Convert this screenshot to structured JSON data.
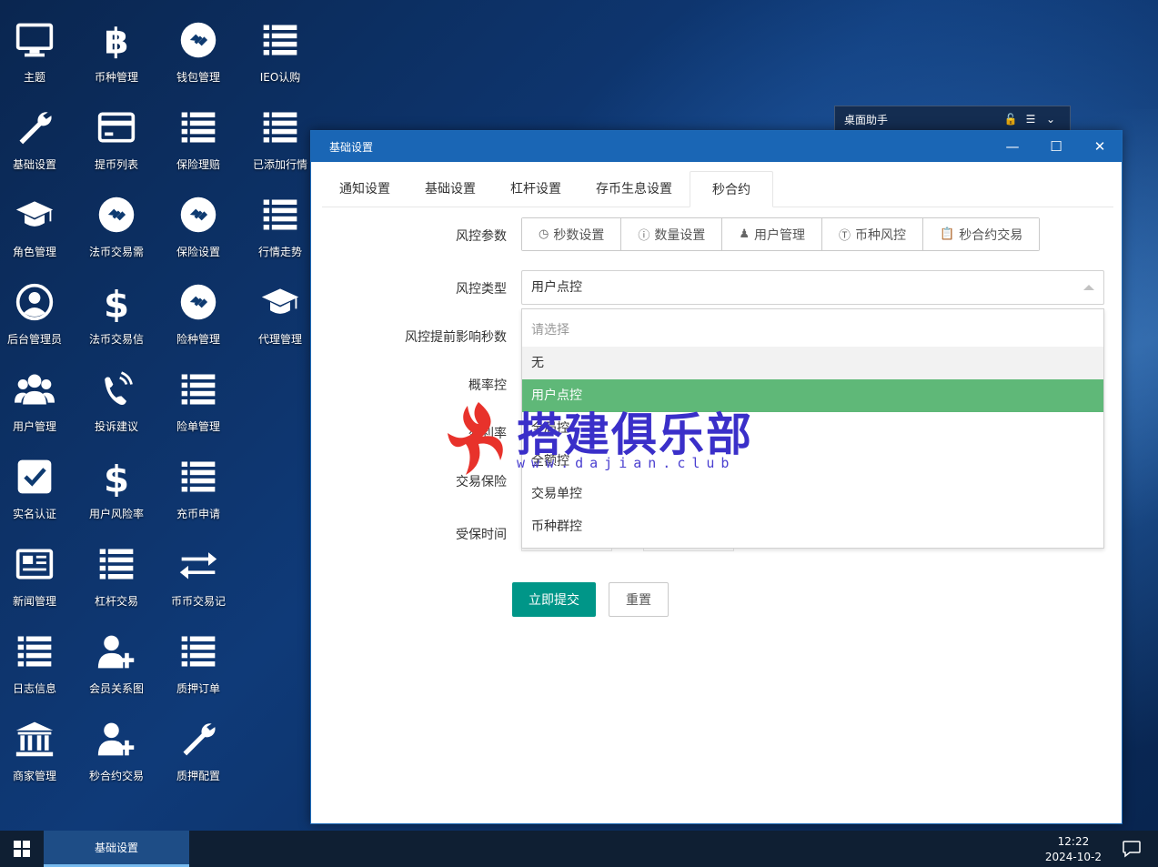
{
  "desktop": {
    "icons": [
      {
        "label": "主题",
        "icon": "monitor-icon"
      },
      {
        "label": "币种管理",
        "icon": "bitcoin-icon"
      },
      {
        "label": "钱包管理",
        "icon": "wallet-link-icon"
      },
      {
        "label": "IEO认购",
        "icon": "list-icon"
      },
      {
        "label": "基础设置",
        "icon": "wrench-icon"
      },
      {
        "label": "提币列表",
        "icon": "credit-card-icon"
      },
      {
        "label": "保险理赔",
        "icon": "list-icon"
      },
      {
        "label": "已添加行情",
        "icon": "list-icon"
      },
      {
        "label": "角色管理",
        "icon": "graduation-cap-icon"
      },
      {
        "label": "法币交易需",
        "icon": "wallet-link-icon"
      },
      {
        "label": "保险设置",
        "icon": "wallet-link-icon"
      },
      {
        "label": "行情走势",
        "icon": "list-icon"
      },
      {
        "label": "后台管理员",
        "icon": "user-circle-icon"
      },
      {
        "label": "法币交易信",
        "icon": "dollar-icon"
      },
      {
        "label": "险种管理",
        "icon": "wallet-link-icon"
      },
      {
        "label": "代理管理",
        "icon": "graduation-cap-icon"
      },
      {
        "label": "用户管理",
        "icon": "users-icon"
      },
      {
        "label": "投诉建议",
        "icon": "phone-icon"
      },
      {
        "label": "险单管理",
        "icon": "list-icon"
      },
      {
        "label": "实名认证",
        "icon": "checkbox-icon"
      },
      {
        "label": "用户风险率",
        "icon": "dollar-icon"
      },
      {
        "label": "充币申请",
        "icon": "list-icon"
      },
      {
        "label": "新闻管理",
        "icon": "newspaper-icon"
      },
      {
        "label": "杠杆交易",
        "icon": "list-icon"
      },
      {
        "label": "币币交易记",
        "icon": "exchange-icon"
      },
      {
        "label": "日志信息",
        "icon": "list-icon"
      },
      {
        "label": "会员关系图",
        "icon": "user-plus-icon"
      },
      {
        "label": "质押订单",
        "icon": "list-icon"
      },
      {
        "label": "商家管理",
        "icon": "bank-icon"
      },
      {
        "label": "秒合约交易",
        "icon": "user-plus-icon"
      },
      {
        "label": "质押配置",
        "icon": "wrench-icon"
      }
    ]
  },
  "helper": {
    "title": "桌面助手"
  },
  "window": {
    "title": "基础设置",
    "tabs": [
      "通知设置",
      "基础设置",
      "杠杆设置",
      "存币生息设置",
      "秒合约"
    ],
    "active_tab": "秒合约",
    "form": {
      "risk_params_label": "风控参数",
      "risk_type_label": "风控类型",
      "advance_seconds_label": "风控提前影响秒数",
      "probability_label": "概率控",
      "profit_label": "盈利率",
      "insurance_label": "交易保险",
      "insured_time_label": "受保时间"
    },
    "param_buttons": [
      {
        "label": "秒数设置",
        "icon": "clock-icon"
      },
      {
        "label": "数量设置",
        "icon": "info-icon"
      },
      {
        "label": "用户管理",
        "icon": "user-icon"
      },
      {
        "label": "币种风控",
        "icon": "coin-icon"
      },
      {
        "label": "秒合约交易",
        "icon": "clipboard-icon"
      }
    ],
    "risk_type_value": "用户点控",
    "dropdown": {
      "placeholder": "请选择",
      "options": [
        "无",
        "用户点控",
        "全局控",
        "全额控",
        "交易单控",
        "币种群控"
      ],
      "selected": "用户点控"
    },
    "submit_label": "立即提交",
    "reset_label": "重置"
  },
  "watermark": {
    "title": "搭建俱乐部",
    "url": "www.dajian.club"
  },
  "taskbar": {
    "task_label": "基础设置",
    "time": "12:22",
    "date": "2024-10-2"
  }
}
